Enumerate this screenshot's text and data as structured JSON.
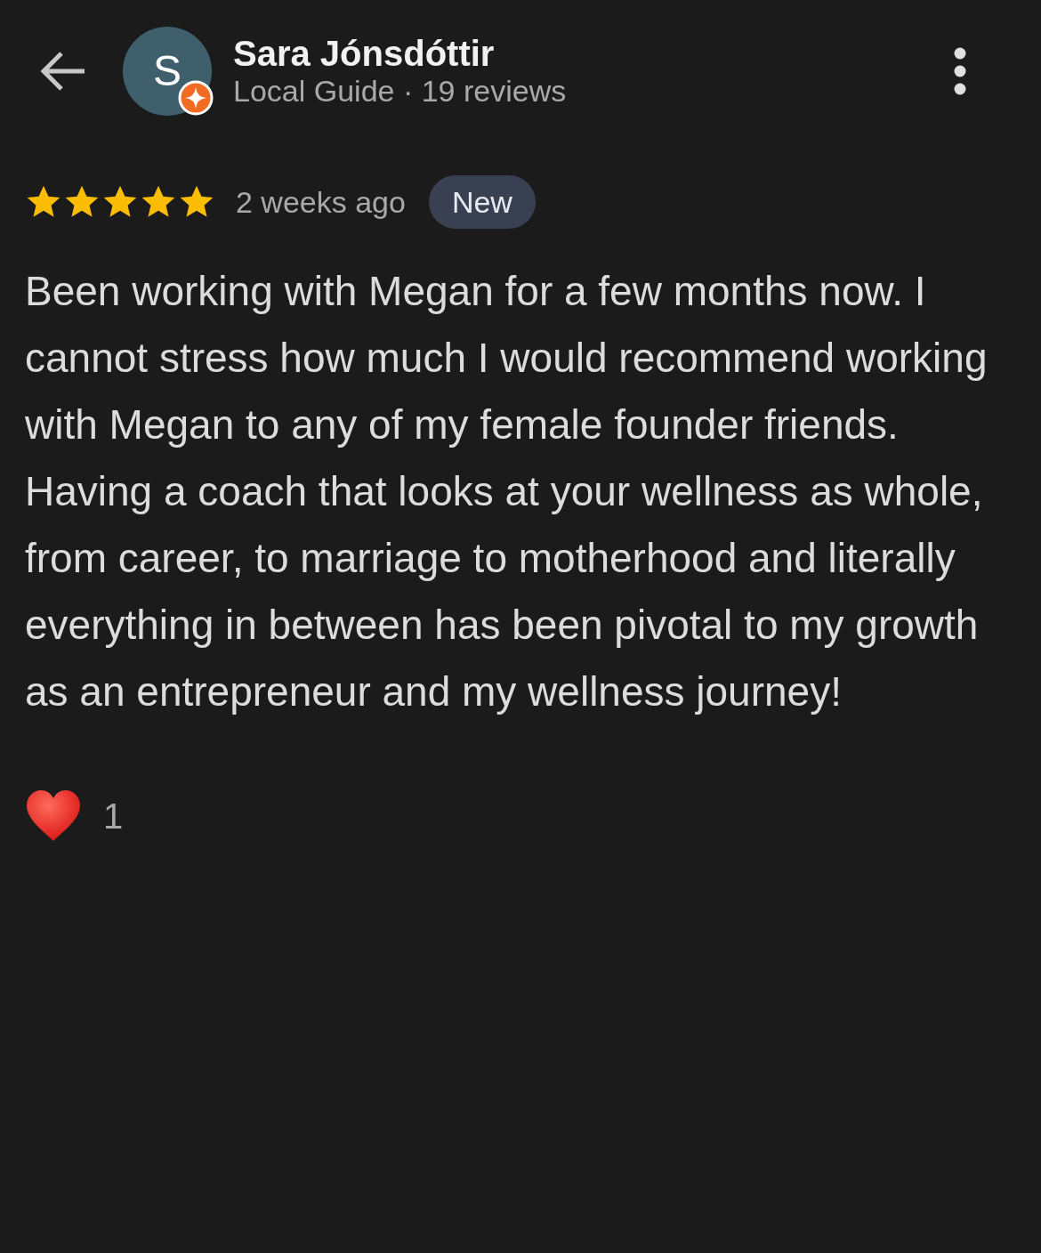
{
  "reviewer": {
    "avatar_letter": "S",
    "local_guide_badge": true,
    "name": "Sara Jónsdóttir",
    "subtitle": "Local Guide · 19 reviews"
  },
  "review": {
    "stars": 5,
    "time": "2 weeks ago",
    "badge": "New",
    "text": "Been working with Megan for a few months now. I cannot stress how much I would recommend working with Megan to any of my female founder friends. Having a coach that looks at your wellness as whole, from career, to marriage to motherhood and literally everything in between has been pivotal to my growth as an entrepreneur and my wellness journey!"
  },
  "reactions": {
    "count": "1"
  }
}
